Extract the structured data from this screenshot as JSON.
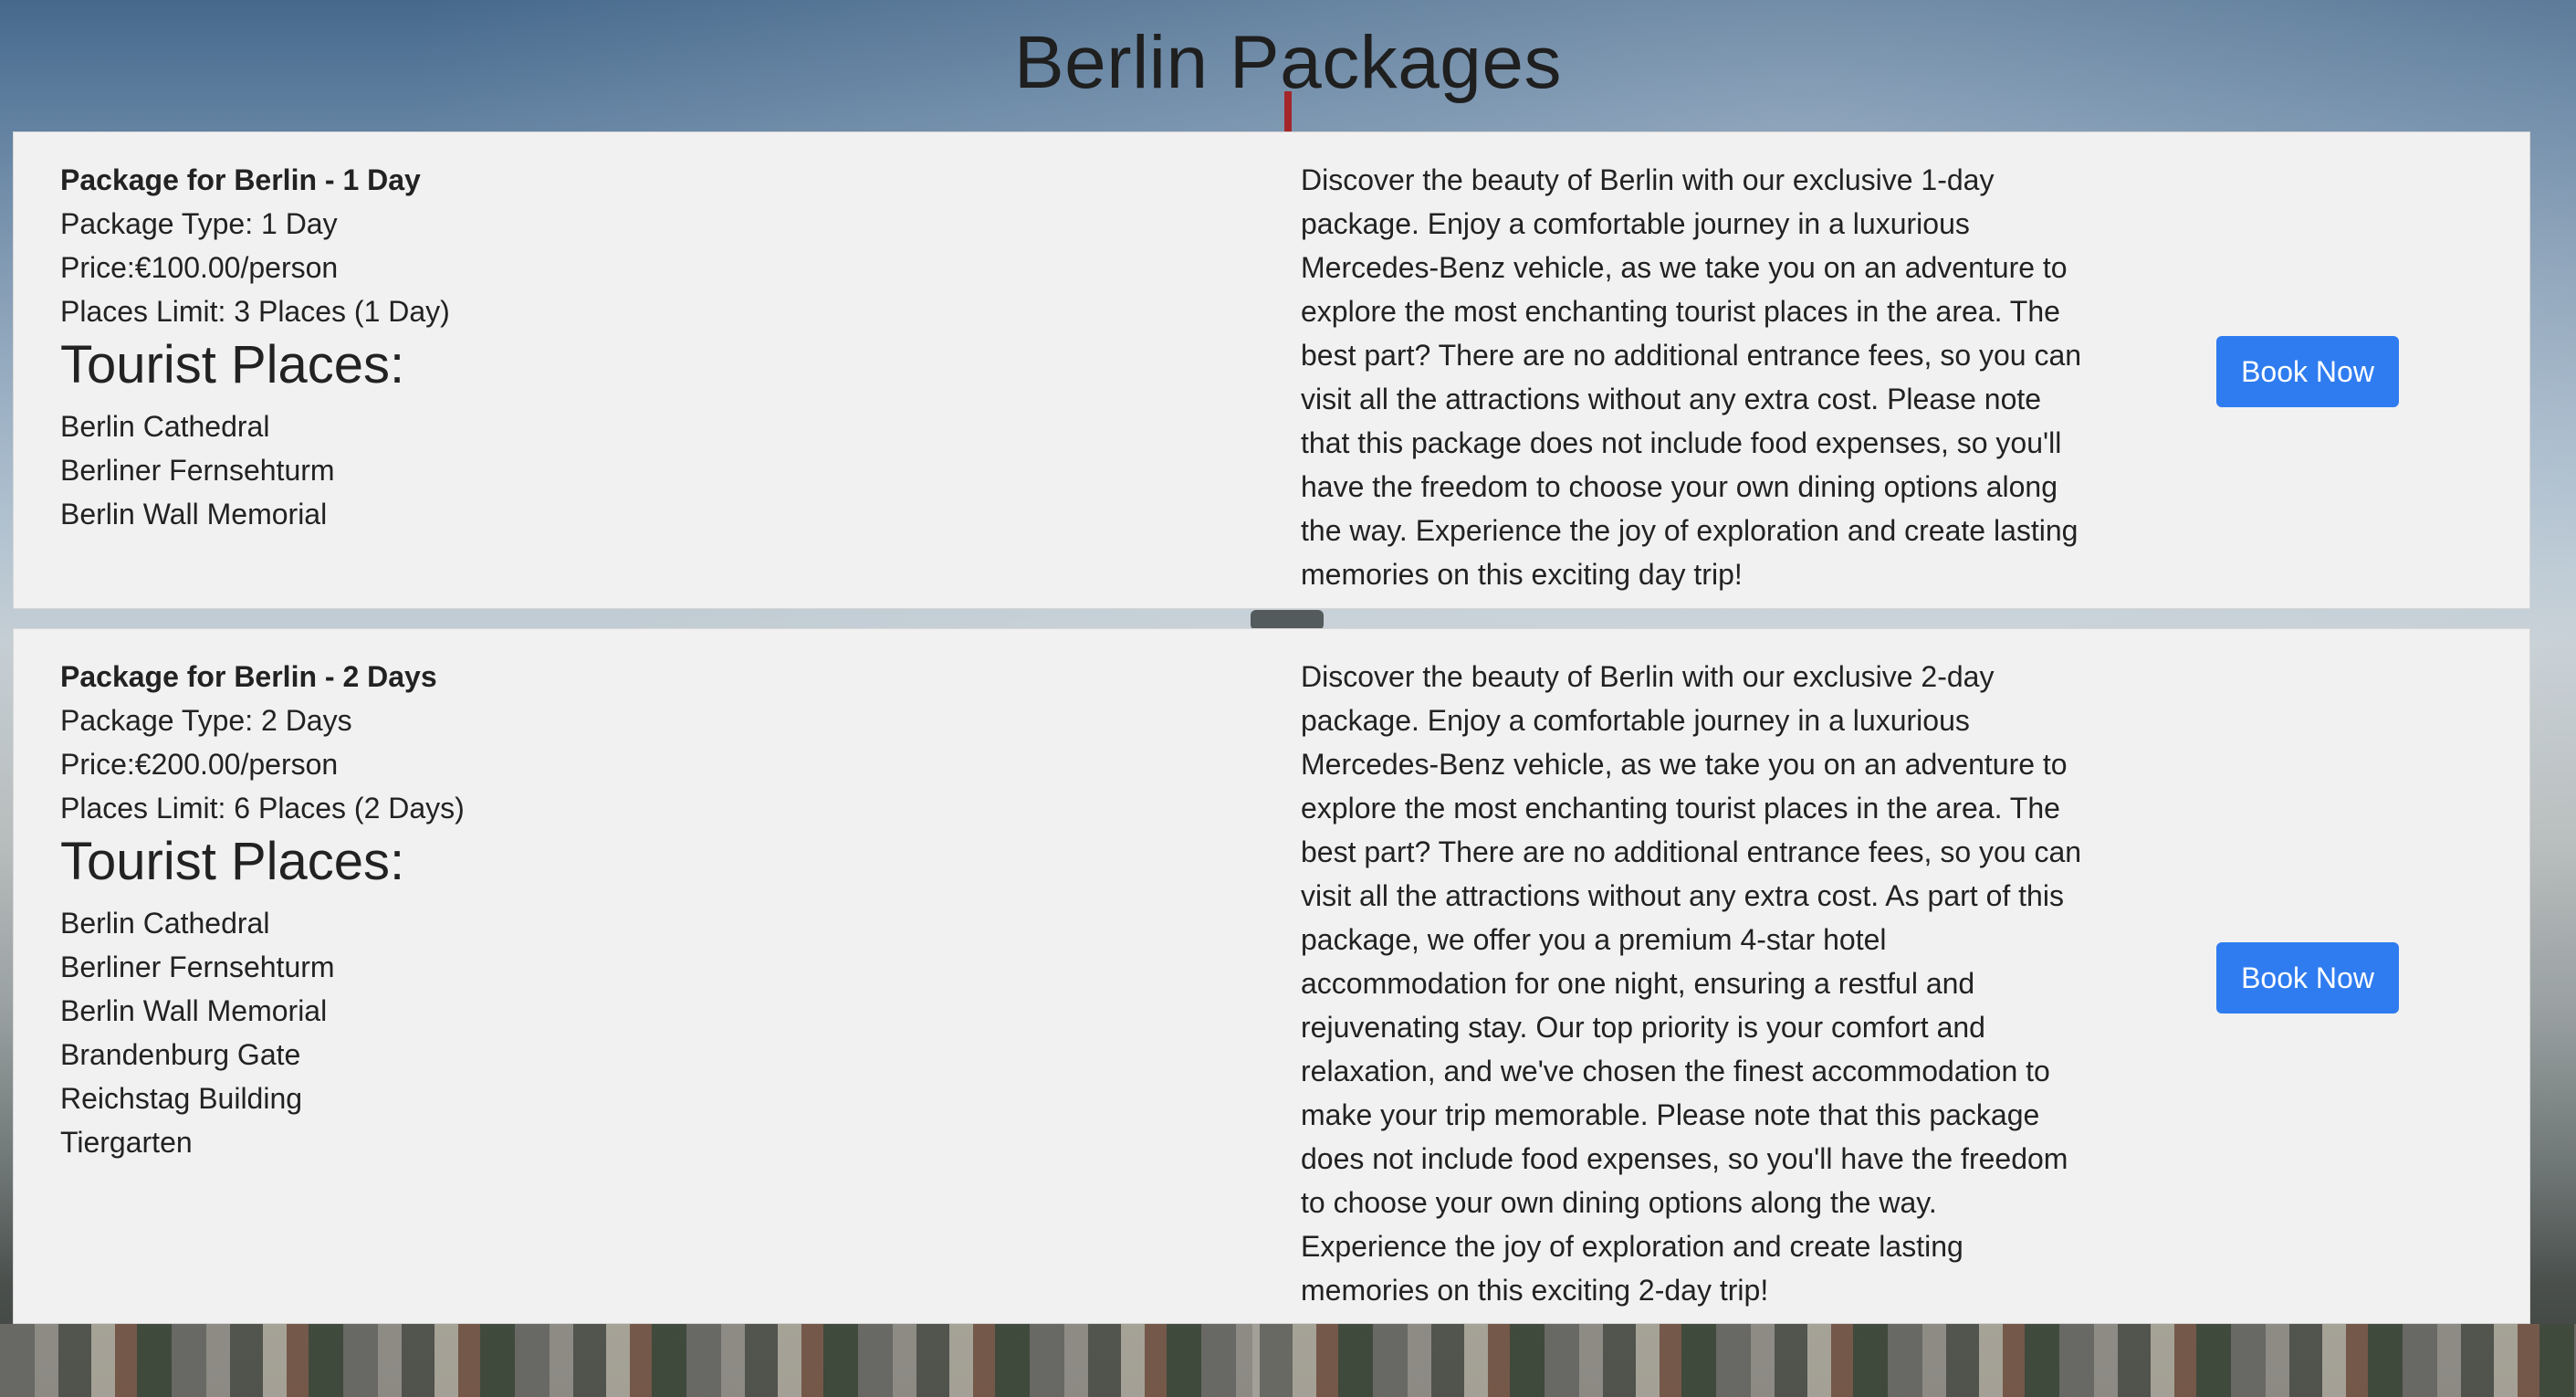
{
  "page": {
    "title": "Berlin Packages"
  },
  "packages": [
    {
      "name": "Package for Berlin - 1 Day",
      "type_line": "Package Type: 1 Day",
      "price_line": "Price:€100.00/person",
      "limit_line": "Places Limit: 3 Places (1 Day)",
      "tourist_places_heading": "Tourist Places:",
      "places": [
        "Berlin Cathedral",
        "Berliner Fernsehturm",
        "Berlin Wall Memorial"
      ],
      "description": "Discover the beauty of Berlin with our exclusive 1-day package. Enjoy a comfortable journey in a luxurious Mercedes-Benz vehicle, as we take you on an adventure to explore the most enchanting tourist places in the area. The best part? There are no additional entrance fees, so you can visit all the attractions without any extra cost. Please note that this package does not include food expenses, so you'll have the freedom to choose your own dining options along the way. Experience the joy of exploration and create lasting memories on this exciting day trip!",
      "button_label": "Book Now"
    },
    {
      "name": "Package for Berlin - 2 Days",
      "type_line": "Package Type: 2 Days",
      "price_line": "Price:€200.00/person",
      "limit_line": "Places Limit: 6 Places (2 Days)",
      "tourist_places_heading": "Tourist Places:",
      "places": [
        "Berlin Cathedral",
        "Berliner Fernsehturm",
        "Berlin Wall Memorial",
        "Brandenburg Gate",
        "Reichstag Building",
        "Tiergarten"
      ],
      "description": "Discover the beauty of Berlin with our exclusive 2-day package. Enjoy a comfortable journey in a luxurious Mercedes-Benz vehicle, as we take you on an adventure to explore the most enchanting tourist places in the area. The best part? There are no additional entrance fees, so you can visit all the attractions without any extra cost. As part of this package, we offer you a premium 4-star hotel accommodation for one night, ensuring a restful and rejuvenating stay. Our top priority is your comfort and relaxation, and we've chosen the finest accommodation to make your trip memorable. Please note that this package does not include food expenses, so you'll have the freedom to choose your own dining options along the way. Experience the joy of exploration and create lasting memories on this exciting 2-day trip!",
      "button_label": "Book Now"
    }
  ],
  "colors": {
    "button": "#2f7cf0",
    "card": "#f1f1f1",
    "text": "#222222"
  }
}
